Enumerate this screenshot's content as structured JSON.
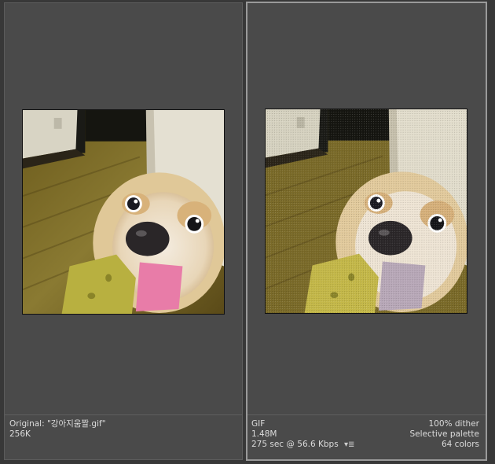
{
  "original": {
    "label": "Original: \"강아지움짤.gif\"",
    "size": "256K",
    "image_desc_icon": "dog-photo"
  },
  "optimized": {
    "format": "GIF",
    "size": "1.48M",
    "download_time": "275 sec @ 56.6 Kbps",
    "speed_menu_icon": "▾≣",
    "dither": "100% dither",
    "palette": "Selective palette",
    "colors": "64 colors"
  },
  "colors": {
    "background": "#4a4a4a",
    "selected_border": "#9a9a9a",
    "text": "#dcdcdc"
  }
}
